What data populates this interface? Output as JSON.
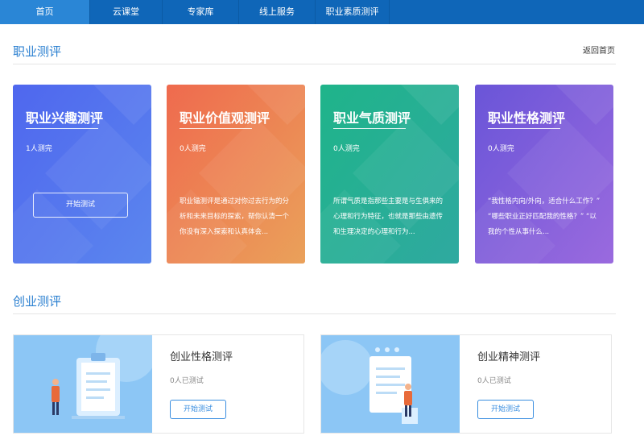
{
  "nav": {
    "items": [
      {
        "label": "首页",
        "active": true
      },
      {
        "label": "云课堂",
        "active": false
      },
      {
        "label": "专家库",
        "active": false
      },
      {
        "label": "线上服务",
        "active": false
      },
      {
        "label": "职业素质测评",
        "active": false
      }
    ]
  },
  "section1": {
    "title": "职业测评",
    "back_link": "返回首页"
  },
  "cards": [
    {
      "title": "职业兴趣测评",
      "count": "1人测完",
      "button": "开始测试",
      "desc": "",
      "color1": "#4f67ee",
      "color2": "#5b86ee"
    },
    {
      "title": "职业价值观测评",
      "count": "0人测完",
      "desc": "职业锚测评是通过对你过去行为的分析和未来目标的探索，帮你认清一个你没有深入探索和认真体会...",
      "color1": "#ef6a4e",
      "color2": "#eaa15a"
    },
    {
      "title": "职业气质测评",
      "count": "0人测完",
      "desc": "所谓气质是指那些主要是与生俱来的心理和行为特征，也就是那些由遗传和生理决定的心理和行为...",
      "color1": "#1fb48a",
      "color2": "#2fa9a0"
    },
    {
      "title": "职业性格测评",
      "count": "0人测完",
      "desc": "“我性格内向/外向，适合什么工作？” “哪些职业正好匹配我的性格？” “以我的个性从事什么...",
      "color1": "#6a55d8",
      "color2": "#9a6ade"
    }
  ],
  "section2": {
    "title": "创业测评"
  },
  "entre_cards": [
    {
      "title": "创业性格测评",
      "count": "0人已测试",
      "button": "开始测试"
    },
    {
      "title": "创业精神测评",
      "count": "0人已测试",
      "button": "开始测试"
    }
  ]
}
